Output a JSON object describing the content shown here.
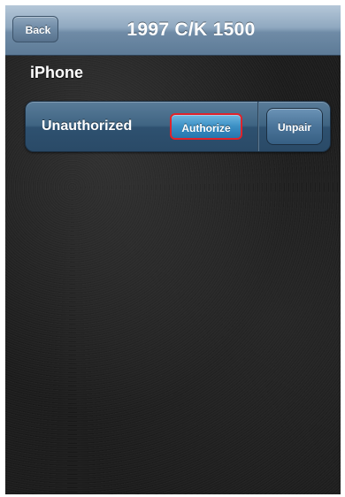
{
  "nav": {
    "back_label": "Back",
    "title": "1997 C/K 1500"
  },
  "section": {
    "header": "iPhone"
  },
  "device": {
    "status": "Unauthorized",
    "authorize_label": "Authorize",
    "unpair_label": "Unpair"
  },
  "colors": {
    "nav_bar": "#8fa8c0",
    "row": "#3f6482",
    "highlight_border": "#e0232a",
    "background": "#1c1c1c"
  }
}
